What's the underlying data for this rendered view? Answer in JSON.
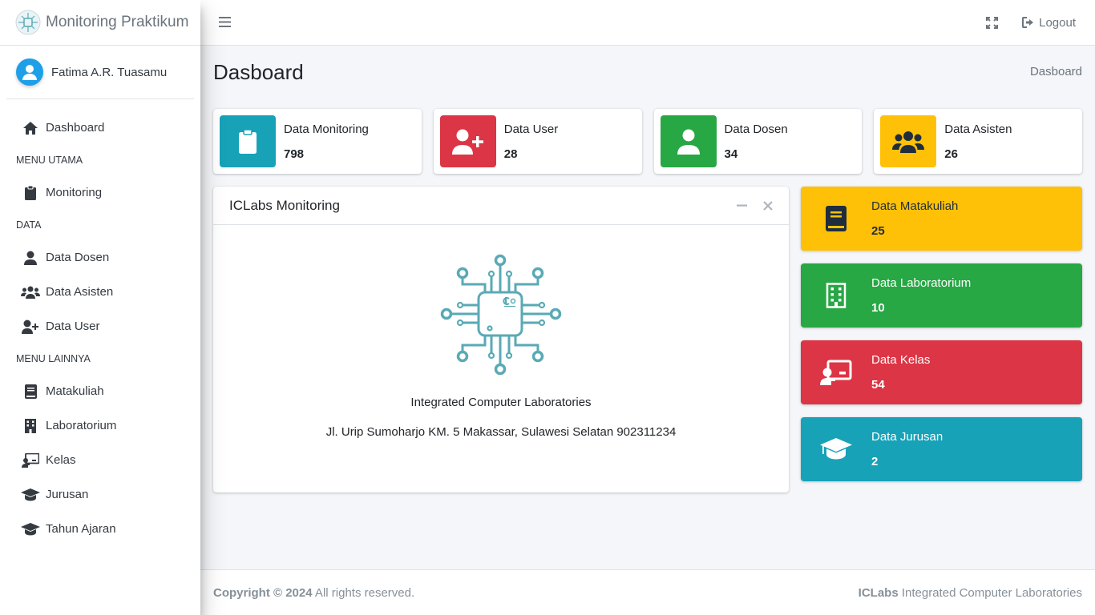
{
  "brand": {
    "title": "Monitoring Praktikum"
  },
  "user": {
    "name": "Fatima A.R. Tuasamu"
  },
  "sidebar": {
    "dashboard": "Dashboard",
    "header_main": "MENU UTAMA",
    "monitoring": "Monitoring",
    "header_data": "DATA",
    "data_dosen": "Data Dosen",
    "data_asisten": "Data Asisten",
    "data_user": "Data User",
    "header_other": "MENU LAINNYA",
    "matakuliah": "Matakuliah",
    "laboratorium": "Laboratorium",
    "kelas": "Kelas",
    "jurusan": "Jurusan",
    "tahun_ajaran": "Tahun Ajaran"
  },
  "topbar": {
    "logout": "Logout"
  },
  "page": {
    "title": "Dasboard",
    "breadcrumb": "Dasboard"
  },
  "info_boxes": [
    {
      "label": "Data Monitoring",
      "value": "798",
      "color": "#17a2b8",
      "icon": "clipboard-icon"
    },
    {
      "label": "Data User",
      "value": "28",
      "color": "#dc3545",
      "icon": "user-plus-icon"
    },
    {
      "label": "Data Dosen",
      "value": "34",
      "color": "#28a745",
      "icon": "user-icon"
    },
    {
      "label": "Data Asisten",
      "value": "26",
      "color": "#ffc107",
      "icon": "users-icon"
    }
  ],
  "card": {
    "title": "ICLabs Monitoring",
    "org": "Integrated Computer Laboratories",
    "address": "Jl. Urip Sumoharjo KM. 5 Makassar, Sulawesi Selatan 902311234"
  },
  "small_boxes": [
    {
      "label": "Data Matakuliah",
      "value": "25",
      "color": "#ffc107",
      "icon": "book-icon"
    },
    {
      "label": "Data Laboratorium",
      "value": "10",
      "color": "#28a745",
      "icon": "building-icon"
    },
    {
      "label": "Data Kelas",
      "value": "54",
      "color": "#dc3545",
      "icon": "chalkboard-teacher-icon"
    },
    {
      "label": "Data Jurusan",
      "value": "2",
      "color": "#17a2b8",
      "icon": "graduation-cap-icon"
    }
  ],
  "footer": {
    "copyright_bold": "Copyright © 2024",
    "copyright_rest": " All rights reserved.",
    "right_bold": "ICLabs",
    "right_rest": " Integrated Computer Laboratories"
  }
}
